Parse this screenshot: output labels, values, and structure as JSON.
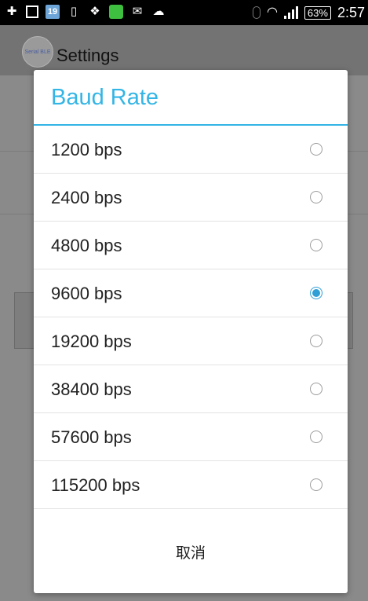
{
  "status_bar": {
    "calendar_day": "19",
    "battery": "63%",
    "time": "2:57"
  },
  "app": {
    "logo_text": "Serial BLE",
    "title": "Settings"
  },
  "dialog": {
    "title": "Baud Rate",
    "selected": "9600 bps",
    "options": [
      {
        "label": "1200 bps",
        "checked": false
      },
      {
        "label": "2400 bps",
        "checked": false
      },
      {
        "label": "4800 bps",
        "checked": false
      },
      {
        "label": "9600 bps",
        "checked": true
      },
      {
        "label": "19200 bps",
        "checked": false
      },
      {
        "label": "38400 bps",
        "checked": false
      },
      {
        "label": "57600 bps",
        "checked": false
      },
      {
        "label": "115200 bps",
        "checked": false
      }
    ],
    "cancel_label": "取消",
    "accent_color": "#33b5e5"
  }
}
